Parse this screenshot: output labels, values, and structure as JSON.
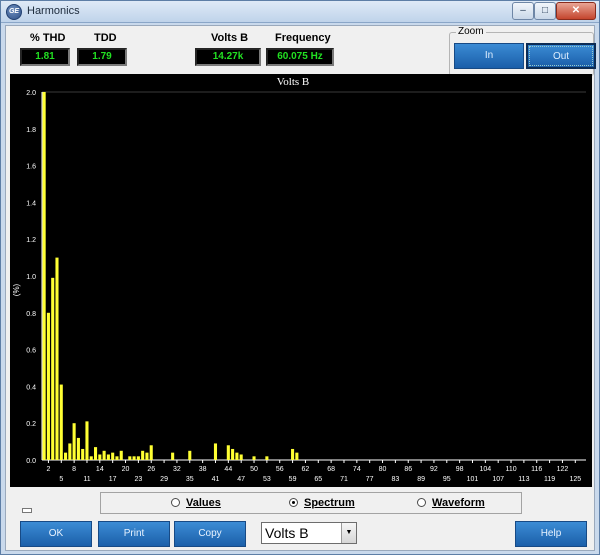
{
  "window": {
    "title": "Harmonics"
  },
  "metrics": {
    "thd": {
      "label": "% THD",
      "value": "1.81"
    },
    "tdd": {
      "label": "TDD",
      "value": "1.79"
    },
    "volts": {
      "label": "Volts B",
      "value": "14.27k"
    },
    "frequency": {
      "label": "Frequency",
      "value": "60.075 Hz"
    }
  },
  "zoom": {
    "legend": "Zoom",
    "in_label": "In",
    "out_label": "Out"
  },
  "modes": {
    "options": [
      {
        "label": "Values",
        "selected": false
      },
      {
        "label": "Spectrum",
        "selected": true
      },
      {
        "label": "Waveform",
        "selected": false
      }
    ]
  },
  "buttons": {
    "ok": "OK",
    "print": "Print",
    "copy": "Copy",
    "help": "Help"
  },
  "channel_select": {
    "value": "Volts B"
  },
  "colors": {
    "bar": "#ffff33",
    "background": "#000000",
    "axis_text": "#ffffff",
    "button_blue": "#2a74c2"
  },
  "chart_data": {
    "type": "bar",
    "title": "Volts B",
    "ylabel": "(%)",
    "xlabel": "",
    "ylim": [
      0,
      2.0
    ],
    "yticks": [
      "0.0",
      "0.2",
      "0.4",
      "0.6",
      "0.8",
      "1.0",
      "1.2",
      "1.4",
      "1.6",
      "1.8",
      "2.0"
    ],
    "xticks_top": [
      "2",
      "8",
      "14",
      "20",
      "26",
      "32",
      "38",
      "44",
      "50",
      "56",
      "62",
      "68",
      "74",
      "80",
      "86",
      "92",
      "98",
      "104",
      "110",
      "116",
      "122"
    ],
    "xticks_bottom": [
      "5",
      "11",
      "17",
      "23",
      "29",
      "35",
      "41",
      "47",
      "53",
      "59",
      "65",
      "71",
      "77",
      "83",
      "89",
      "95",
      "101",
      "107",
      "113",
      "119",
      "125"
    ],
    "harmonic_max": 127,
    "harmonics": [
      1,
      2,
      3,
      4,
      5,
      6,
      7,
      8,
      9,
      10,
      11,
      12,
      13,
      14,
      15,
      16,
      17,
      18,
      19,
      21,
      22,
      23,
      24,
      25,
      26,
      31,
      35,
      41,
      44,
      45,
      46,
      47,
      50,
      53,
      59,
      60
    ],
    "values": [
      2.0,
      0.8,
      0.99,
      1.1,
      0.41,
      0.04,
      0.09,
      0.2,
      0.12,
      0.06,
      0.21,
      0.02,
      0.07,
      0.03,
      0.05,
      0.03,
      0.04,
      0.02,
      0.05,
      0.02,
      0.02,
      0.02,
      0.05,
      0.04,
      0.08,
      0.04,
      0.05,
      0.09,
      0.08,
      0.06,
      0.04,
      0.03,
      0.02,
      0.02,
      0.06,
      0.04
    ]
  }
}
